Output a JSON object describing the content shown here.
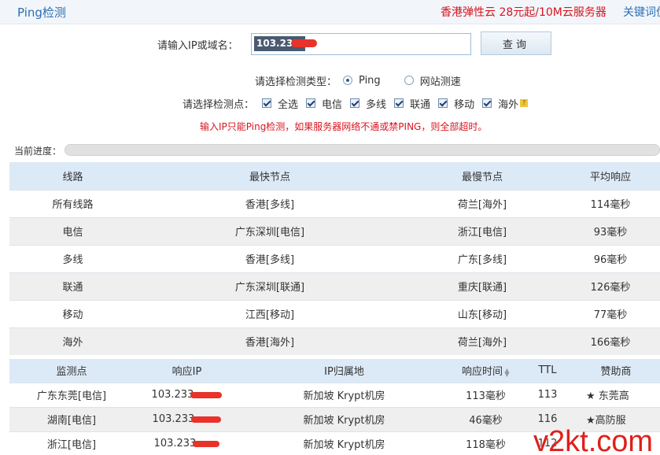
{
  "header": {
    "title": "Ping检测",
    "ad_text": "香港弹性云 28元起/10M云服务器",
    "keyword_link": "关键词优"
  },
  "query": {
    "label": "请输入IP或域名：",
    "input_value": "103.233.",
    "button_label": "查询"
  },
  "detect_type": {
    "label": "请选择检测类型：",
    "options": [
      {
        "label": "Ping",
        "selected": true
      },
      {
        "label": "网站测速",
        "selected": false
      }
    ]
  },
  "detect_nodes": {
    "label": "请选择检测点：",
    "options": [
      "全选",
      "电信",
      "多线",
      "联通",
      "移动",
      "海外"
    ]
  },
  "notice": "输入IP只能Ping检测，如果服务器网络不通或禁PING，则全部超时。",
  "progress": {
    "label": "当前进度：",
    "value": 0
  },
  "summary_table": {
    "headers": [
      "线路",
      "最快节点",
      "最慢节点",
      "平均响应"
    ],
    "rows": [
      [
        "所有线路",
        "香港[多线]",
        "荷兰[海外]",
        "114毫秒"
      ],
      [
        "电信",
        "广东深圳[电信]",
        "浙江[电信]",
        "93毫秒"
      ],
      [
        "多线",
        "香港[多线]",
        "广东[多线]",
        "96毫秒"
      ],
      [
        "联通",
        "广东深圳[联通]",
        "重庆[联通]",
        "126毫秒"
      ],
      [
        "移动",
        "江西[移动]",
        "山东[移动]",
        "77毫秒"
      ],
      [
        "海外",
        "香港[海外]",
        "荷兰[海外]",
        "166毫秒"
      ]
    ]
  },
  "detail_table": {
    "headers": [
      "监测点",
      "响应IP",
      "IP归属地",
      "响应时间",
      "TTL",
      "赞助商"
    ],
    "rows": [
      {
        "node": "广东东莞[电信]",
        "ip": "103.233.",
        "location": "新加坡 Krypt机房",
        "time": "113毫秒",
        "ttl": "113",
        "sponsor": "★ 东莞高"
      },
      {
        "node": "湖南[电信]",
        "ip": "103.233.",
        "location": "新加坡 Krypt机房",
        "time": "46毫秒",
        "ttl": "116",
        "sponsor": "★高防服"
      },
      {
        "node": "浙江[电信]",
        "ip": "103.233.",
        "location": "新加坡 Krypt机房",
        "time": "118毫秒",
        "ttl": "112",
        "sponsor": ""
      }
    ]
  },
  "watermark": "v2kt.com",
  "colors": {
    "accent_blue": "#2a6fb5",
    "alert_red": "#d8141e",
    "ip_green": "#2e8b2e",
    "table_header_bg": "#dce9f6"
  }
}
